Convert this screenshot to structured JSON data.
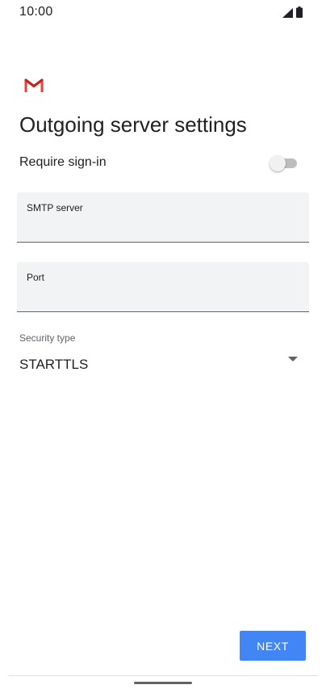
{
  "status_bar": {
    "time": "10:00",
    "icons": [
      "signal-icon",
      "battery-icon"
    ]
  },
  "app": {
    "logo": "gmail-logo-icon",
    "brand_colors": [
      "#ea4335",
      "#c5221f"
    ]
  },
  "page": {
    "title": "Outgoing server settings"
  },
  "require_sign_in": {
    "label": "Require sign-in",
    "enabled": false
  },
  "fields": {
    "smtp_server": {
      "label": "SMTP server",
      "value": ""
    },
    "port": {
      "label": "Port",
      "value": ""
    }
  },
  "security": {
    "label": "Security type",
    "selected": "STARTTLS",
    "icon": "dropdown-arrow-icon"
  },
  "actions": {
    "next_label": "NEXT"
  },
  "colors": {
    "accent": "#4285f4",
    "field_background": "#f1f3f4",
    "text_primary": "#202124",
    "text_secondary": "#5f6368"
  }
}
